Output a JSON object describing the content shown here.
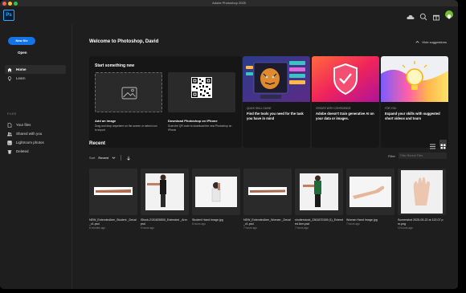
{
  "window": {
    "title": "Adobe Photoshop 2025"
  },
  "app": {
    "logo": "Ps"
  },
  "topbar": {
    "icons": [
      "cloud-icon",
      "search-icon",
      "gift-icon",
      "lightbulb-icon"
    ]
  },
  "sidebar": {
    "new_file": "New file",
    "open": "Open",
    "nav": [
      {
        "label": "Home",
        "icon": "home-icon",
        "active": true
      },
      {
        "label": "Learn",
        "icon": "lightbulb-icon",
        "active": false
      }
    ],
    "section": "FILES",
    "files": [
      {
        "label": "Your files",
        "icon": "file-icon"
      },
      {
        "label": "Shared with you",
        "icon": "people-icon"
      },
      {
        "label": "Lightroom photos",
        "icon": "lightroom-icon"
      },
      {
        "label": "Deleted",
        "icon": "trash-icon"
      }
    ]
  },
  "main": {
    "welcome": "Welcome to Photoshop, David",
    "hide_suggestions": "Hide suggestions",
    "start": {
      "title": "Start something new",
      "add_image_title": "Add an image",
      "add_image_desc": "Drag and drop anywhere on the screen or select icon to import",
      "download_title": "Download Photoshop on iPhone",
      "download_desc": "Scan the QR code to download the new Photoshop on iPhone"
    },
    "cards": [
      {
        "kicker": "QUICK SKILL GUIDE",
        "title": "Find the tools you need for the task you have in mind"
      },
      {
        "kicker": "CREATE WITH CONFIDENCE",
        "title": "Adobe doesn't train generative AI on your data or images."
      },
      {
        "kicker": "FOR YOU",
        "title": "Expand your skills with suggested short videos and tours"
      }
    ],
    "recent": {
      "title": "Recent",
      "sort_label": "Sort",
      "sort_value": "Recent",
      "filter_label": "Filter",
      "filter_placeholder": "Filter Recent Files",
      "files": [
        {
          "name": "NEW_ExtendedArm_Student _Decal_v1.psd",
          "time": "6 minutes ago"
        },
        {
          "name": "iStock-2151826500_Extended _Arm.psd",
          "time": "6 hours ago"
        },
        {
          "name": "Student Hand Image.jpg",
          "time": "6 hours ago"
        },
        {
          "name": "NEW_ExtendedArm_Woman _Decal_v1.psd",
          "time": "7 hours ago"
        },
        {
          "name": "shutterstock_2361870155 (1)_Extended Arm.psd",
          "time": "7 hours ago"
        },
        {
          "name": "Woman Hand Image.jpg",
          "time": "7 hours ago"
        },
        {
          "name": "Screenshot 2025-05-22 at 122.07 pm.png",
          "time": "10 hours ago"
        }
      ]
    }
  }
}
